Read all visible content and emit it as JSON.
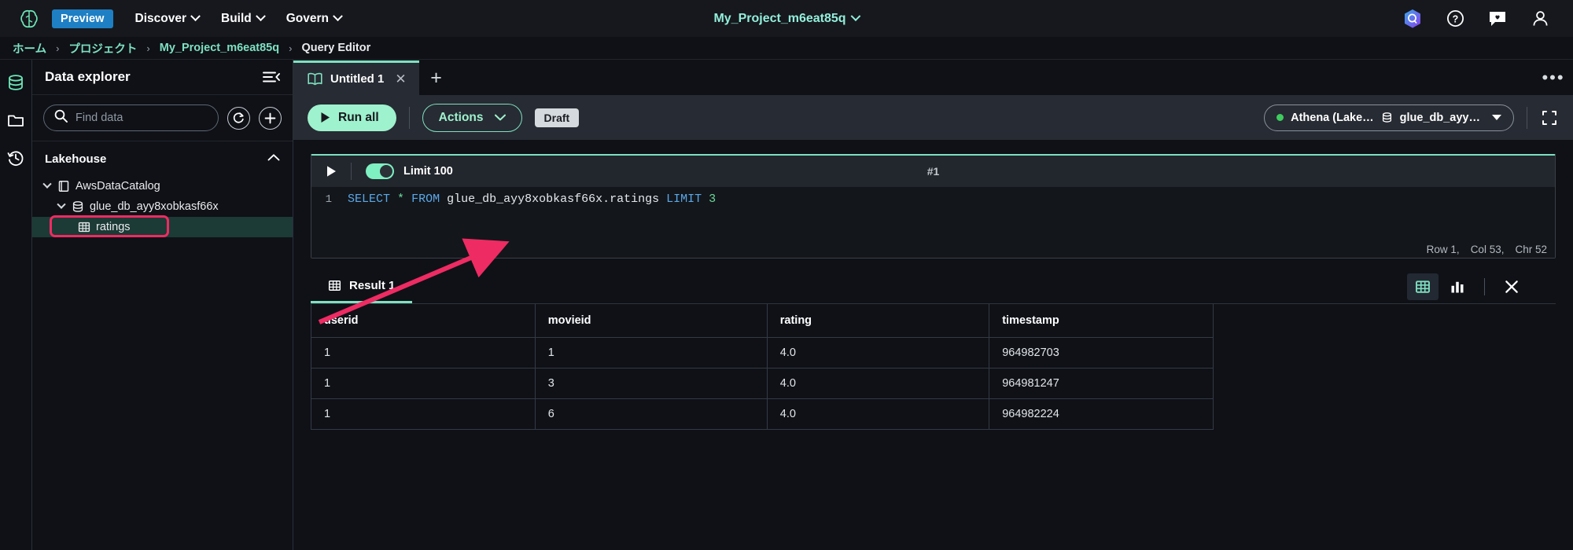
{
  "topnav": {
    "logo_icon": "brain-logo-icon",
    "preview_badge": "Preview",
    "items": [
      {
        "label": "Discover",
        "icon": "chevron-down-icon"
      },
      {
        "label": "Build",
        "icon": "chevron-down-icon"
      },
      {
        "label": "Govern",
        "icon": "chevron-down-icon"
      }
    ],
    "project_title": "My_Project_m6eat85q",
    "right_icons": [
      {
        "name": "amazon-q-icon"
      },
      {
        "name": "help-circle-icon"
      },
      {
        "name": "feedback-icon"
      },
      {
        "name": "user-profile-icon"
      }
    ]
  },
  "breadcrumb": {
    "items": [
      "ホーム",
      "プロジェクト",
      "My_Project_m6eat85q",
      "Query Editor"
    ],
    "separator": "›"
  },
  "rail": {
    "items": [
      {
        "name": "data-icon",
        "label": "Data"
      },
      {
        "name": "folder-icon",
        "label": "Files"
      },
      {
        "name": "history-icon",
        "label": "History"
      }
    ]
  },
  "sidebar": {
    "title": "Data explorer",
    "collapse_icon": "collapse-panel-icon",
    "search": {
      "placeholder": "Find data",
      "value": "",
      "icon": "search-icon"
    },
    "refresh_icon": "refresh-icon",
    "add_icon": "plus-icon",
    "section": {
      "title": "Lakehouse",
      "chevron": "chevron-up-icon"
    },
    "tree": [
      {
        "label": "AwsDataCatalog",
        "level": 1,
        "icon": "catalog-icon",
        "expanded": true,
        "selected": false
      },
      {
        "label": "glue_db_ayy8xobkasf66x",
        "level": 2,
        "icon": "database-icon",
        "expanded": true,
        "selected": false
      },
      {
        "label": "ratings",
        "level": 3,
        "icon": "table-icon",
        "expanded": false,
        "selected": true,
        "annotated": true
      }
    ]
  },
  "main": {
    "tab": {
      "label": "Untitled 1",
      "icon": "notebook-icon",
      "close_icon": "close-icon"
    },
    "add_tab_icon": "plus-icon",
    "more_icon": "more-horizontal-icon",
    "toolbar": {
      "run_all": "Run all",
      "run_icon": "play-icon",
      "actions": "Actions",
      "actions_chevron": "chevron-down-icon",
      "status_badge": "Draft",
      "connection": {
        "engine": "Athena (Lake…",
        "database": "glue_db_ayy…",
        "status_color": "#3ecc5f",
        "db_icon": "database-icon",
        "chevron": "chevron-down-icon"
      },
      "collapse_icon": "compress-icon"
    },
    "cell": {
      "run_icon": "play-icon",
      "limit_toggle": {
        "label": "Limit 100",
        "on": true
      },
      "number": "#1",
      "line_number": "1",
      "code": {
        "tokens": [
          {
            "t": "SELECT",
            "type": "kw"
          },
          {
            "t": " ",
            "type": "plain"
          },
          {
            "t": "*",
            "type": "star"
          },
          {
            "t": " ",
            "type": "plain"
          },
          {
            "t": "FROM",
            "type": "kw"
          },
          {
            "t": " glue_db_ayy8xobkasf66x.ratings ",
            "type": "ident"
          },
          {
            "t": "LIMIT",
            "type": "kw"
          },
          {
            "t": " ",
            "type": "plain"
          },
          {
            "t": "3",
            "type": "num"
          }
        ],
        "full_text": "SELECT * FROM glue_db_ayy8xobkasf66x.ratings LIMIT 3"
      },
      "status": [
        "Row 1,",
        "Col 53,",
        "Chr 52"
      ]
    },
    "results": {
      "tab": {
        "label": "Result 1",
        "icon": "table-icon"
      },
      "view_icons": [
        {
          "name": "table-view-icon",
          "active": true
        },
        {
          "name": "chart-view-icon",
          "active": false
        },
        {
          "name": "close-results-icon",
          "active": false
        }
      ],
      "columns": [
        "userid",
        "movieid",
        "rating",
        "timestamp"
      ],
      "rows": [
        [
          "1",
          "1",
          "4.0",
          "964982703"
        ],
        [
          "1",
          "3",
          "4.0",
          "964981247"
        ],
        [
          "1",
          "6",
          "4.0",
          "964982224"
        ]
      ]
    }
  },
  "annotations": {
    "highlight_color": "#ee2b62",
    "arrow_target": "ratings"
  }
}
